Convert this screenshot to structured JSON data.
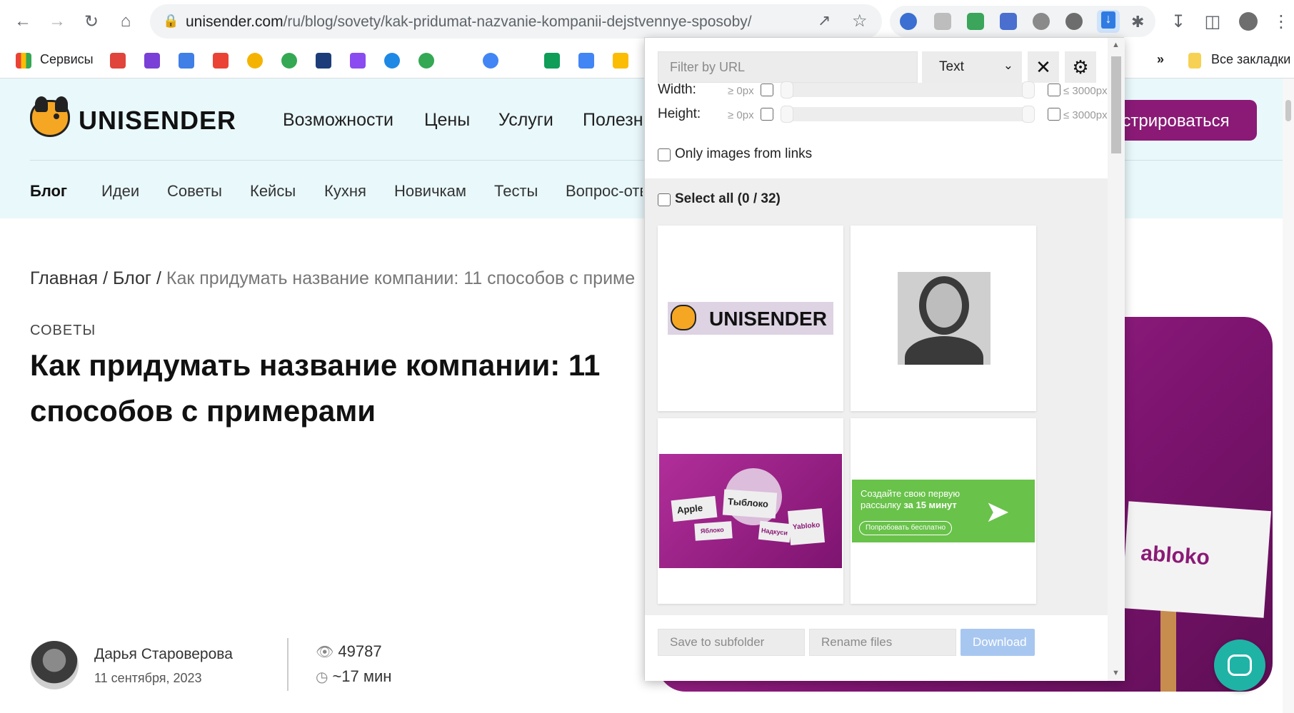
{
  "browser": {
    "url_host": "unisender.com",
    "url_path": "/ru/blog/sovety/kak-pridumat-nazvanie-kompanii-dejstvennye-sposoby/",
    "bookmarks_services": "Сервисы",
    "bookmarks_more": "»",
    "all_bookmarks": "Все закладки"
  },
  "site": {
    "logo": "UNISENDER",
    "main_nav": [
      "Возможности",
      "Цены",
      "Услуги",
      "Полезно"
    ],
    "register_button": "истрироваться",
    "sub_nav": [
      "Блог",
      "Идеи",
      "Советы",
      "Кейсы",
      "Кухня",
      "Новичкам",
      "Тесты",
      "Вопрос-отв"
    ],
    "breadcrumb": {
      "home": "Главная",
      "sep1": "/",
      "blog": "Блог",
      "sep2": "/",
      "current": "Как придумать название компании: 11 способов с приме"
    },
    "category": "СОВЕТЫ",
    "title": "Как придумать название компании: 11 способов с примерами",
    "hero_sign_text": "abloko",
    "author": {
      "name": "Дарья Староверова",
      "date": "11 сентября, 2023"
    },
    "views": "49787",
    "read_time": "~17 мин"
  },
  "popup": {
    "filter_placeholder": "Filter by URL",
    "type_value": "Text",
    "width_label": "Width:",
    "height_label": "Height:",
    "min_label": "≥ 0px",
    "max_label": "≤ 3000px",
    "only_links_label": "Only images from links",
    "select_all_label": "Select all (0 / 32)",
    "cards": {
      "logo_text": "UNISENDER",
      "apple": "Apple",
      "tybloko": "Тыблоко",
      "yabloko_ru": "Яблоко",
      "nadkus": "Надкуси",
      "yabloko": "Yabloko",
      "promo_line1": "Создайте свою первую",
      "promo_line2_a": "рассылку ",
      "promo_line2_b": "за 15 минут",
      "promo_button": "Попробовать бесплатно"
    },
    "subfolder_placeholder": "Save to subfolder",
    "rename_placeholder": "Rename files",
    "download_label": "Download"
  },
  "colors": {
    "brand_purple": "#8a1a76",
    "header_bg": "#e9f8fb",
    "chat_teal": "#1fb3a6",
    "download_blue": "#a8c7f0",
    "promo_green": "#69c24a"
  }
}
